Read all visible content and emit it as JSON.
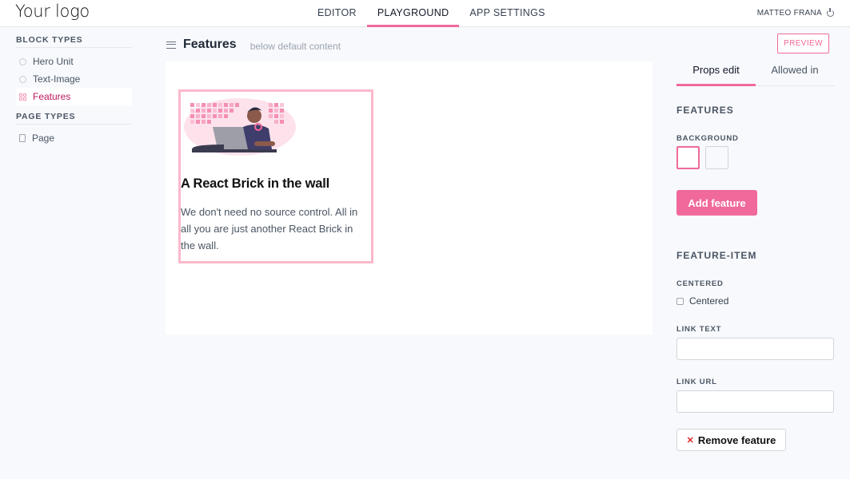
{
  "header": {
    "logo": "Your logo",
    "nav": [
      {
        "label": "EDITOR"
      },
      {
        "label": "PLAYGROUND"
      },
      {
        "label": "APP SETTINGS"
      }
    ],
    "active_nav": "PLAYGROUND",
    "user_name": "MATTEO FRANA"
  },
  "sidebar": {
    "block_types_title": "BLOCK TYPES",
    "block_types": [
      {
        "label": "Hero Unit",
        "icon": "cube-icon"
      },
      {
        "label": "Text-Image",
        "icon": "cube-icon"
      },
      {
        "label": "Features",
        "icon": "grid-icon",
        "active": true
      }
    ],
    "page_types_title": "PAGE TYPES",
    "page_types": [
      {
        "label": "Page",
        "icon": "page-icon"
      }
    ]
  },
  "toolbar": {
    "title": "Features",
    "subtitle": "below default content",
    "preview_label": "PREVIEW"
  },
  "canvas": {
    "feature": {
      "title": "A React Brick in the wall",
      "text": "We don't need no source control. All in all you are just another React Brick in the wall."
    }
  },
  "panel": {
    "tabs": [
      {
        "label": "Props edit"
      },
      {
        "label": "Allowed in"
      }
    ],
    "features_heading": "FEATURES",
    "background_label": "BACKGROUND",
    "add_feature_label": "Add feature",
    "feature_item_heading": "FEATURE-ITEM",
    "centered_label": "CENTERED",
    "centered_checkbox_label": "Centered",
    "link_text_label": "LINK TEXT",
    "link_url_label": "LINK URL",
    "remove_feature_label": "Remove feature",
    "link_text_value": "",
    "link_url_value": ""
  },
  "colors": {
    "accent": "#f0699a",
    "active_text": "#be185d",
    "feature_border": "#fbb8cb"
  }
}
